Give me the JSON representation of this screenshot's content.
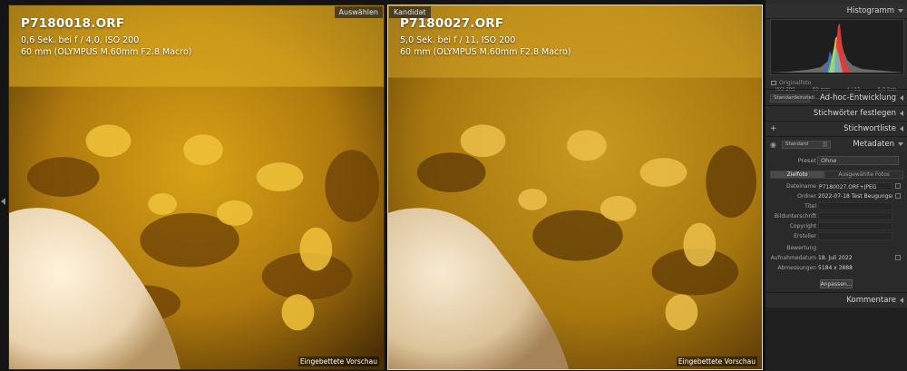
{
  "compare": {
    "left": {
      "name": "P7180018.ORF",
      "line1": "0,6 Sek. bei f / 4,0, ISO 200",
      "line2": "60 mm (OLYMPUS M.60mm F2.8 Macro)",
      "badge": "Auswählen",
      "preview": "Eingebettete Vorschau"
    },
    "right": {
      "name": "P7180027.ORF",
      "line1": "5,0 Sek. bei f / 11, ISO 200",
      "line2": "60 mm (OLYMPUS M.60mm F2.8 Macro)",
      "badge": "Kandidat",
      "preview": "Eingebettete Vorschau"
    }
  },
  "panel": {
    "histogram": {
      "title": "Histogramm",
      "iso": "ISO 200",
      "focal": "60 mm",
      "aperture": "f / 11",
      "shutter": "5,0 Sek.",
      "original": "Originalfoto"
    },
    "quick_develop": {
      "select": "Standardeinstell...",
      "title": "Ad-hoc-Entwicklung"
    },
    "keywording": {
      "title": "Stichwörter festlegen"
    },
    "keyword_list": {
      "plus": "+",
      "title": "Stichwortliste"
    },
    "metadata": {
      "select": "Standard",
      "title": "Metadaten",
      "preset_label": "Preset",
      "preset_value": "Ohne",
      "tab_target": "Zielfoto",
      "tab_selected": "Ausgewählte Fotos",
      "fields": [
        {
          "key": "Dateiname",
          "value": "P7180027.ORF+JPEG"
        },
        {
          "key": "Ordner",
          "value": "2022-07-18 Test Beugungsuns..."
        },
        {
          "key": "Titel",
          "value": ""
        },
        {
          "key": "Bildunterschrift",
          "value": ""
        },
        {
          "key": "Copyright",
          "value": ""
        },
        {
          "key": "Ersteller",
          "value": ""
        },
        {
          "key": "Bewertung",
          "value": ""
        },
        {
          "key": "Aufnahmedatum",
          "value": "18. Juli 2022"
        },
        {
          "key": "Abmessungen",
          "value": "5184 x 3888"
        }
      ],
      "button": "Anpassen..."
    },
    "comments": {
      "title": "Kommentare"
    }
  }
}
